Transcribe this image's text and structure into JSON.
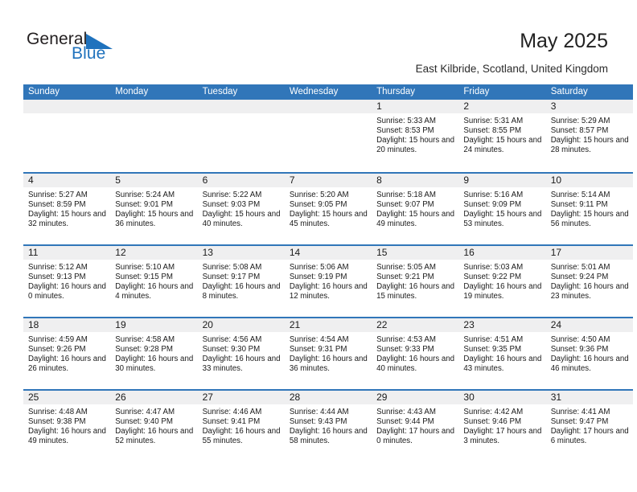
{
  "brand": {
    "name_top": "General",
    "name_bottom": "Blue",
    "color_top": "#231f20",
    "color_bottom": "#1f72bd",
    "triangle_color": "#1f72bd",
    "logo_icon": "triangle-flag-icon"
  },
  "header": {
    "title": "May 2025",
    "subtitle": "East Kilbride, Scotland, United Kingdom"
  },
  "theme": {
    "header_blue": "#3176b9",
    "day_band_gray": "#efeff0",
    "text": "#1a1a1a"
  },
  "weekdays": [
    "Sunday",
    "Monday",
    "Tuesday",
    "Wednesday",
    "Thursday",
    "Friday",
    "Saturday"
  ],
  "weeks": [
    [
      {
        "day": "",
        "empty": true
      },
      {
        "day": "",
        "empty": true
      },
      {
        "day": "",
        "empty": true
      },
      {
        "day": "",
        "empty": true
      },
      {
        "day": "1",
        "sunrise": "Sunrise: 5:33 AM",
        "sunset": "Sunset: 8:53 PM",
        "daylight": "Daylight: 15 hours and 20 minutes."
      },
      {
        "day": "2",
        "sunrise": "Sunrise: 5:31 AM",
        "sunset": "Sunset: 8:55 PM",
        "daylight": "Daylight: 15 hours and 24 minutes."
      },
      {
        "day": "3",
        "sunrise": "Sunrise: 5:29 AM",
        "sunset": "Sunset: 8:57 PM",
        "daylight": "Daylight: 15 hours and 28 minutes."
      }
    ],
    [
      {
        "day": "4",
        "sunrise": "Sunrise: 5:27 AM",
        "sunset": "Sunset: 8:59 PM",
        "daylight": "Daylight: 15 hours and 32 minutes."
      },
      {
        "day": "5",
        "sunrise": "Sunrise: 5:24 AM",
        "sunset": "Sunset: 9:01 PM",
        "daylight": "Daylight: 15 hours and 36 minutes."
      },
      {
        "day": "6",
        "sunrise": "Sunrise: 5:22 AM",
        "sunset": "Sunset: 9:03 PM",
        "daylight": "Daylight: 15 hours and 40 minutes."
      },
      {
        "day": "7",
        "sunrise": "Sunrise: 5:20 AM",
        "sunset": "Sunset: 9:05 PM",
        "daylight": "Daylight: 15 hours and 45 minutes."
      },
      {
        "day": "8",
        "sunrise": "Sunrise: 5:18 AM",
        "sunset": "Sunset: 9:07 PM",
        "daylight": "Daylight: 15 hours and 49 minutes."
      },
      {
        "day": "9",
        "sunrise": "Sunrise: 5:16 AM",
        "sunset": "Sunset: 9:09 PM",
        "daylight": "Daylight: 15 hours and 53 minutes."
      },
      {
        "day": "10",
        "sunrise": "Sunrise: 5:14 AM",
        "sunset": "Sunset: 9:11 PM",
        "daylight": "Daylight: 15 hours and 56 minutes."
      }
    ],
    [
      {
        "day": "11",
        "sunrise": "Sunrise: 5:12 AM",
        "sunset": "Sunset: 9:13 PM",
        "daylight": "Daylight: 16 hours and 0 minutes."
      },
      {
        "day": "12",
        "sunrise": "Sunrise: 5:10 AM",
        "sunset": "Sunset: 9:15 PM",
        "daylight": "Daylight: 16 hours and 4 minutes."
      },
      {
        "day": "13",
        "sunrise": "Sunrise: 5:08 AM",
        "sunset": "Sunset: 9:17 PM",
        "daylight": "Daylight: 16 hours and 8 minutes."
      },
      {
        "day": "14",
        "sunrise": "Sunrise: 5:06 AM",
        "sunset": "Sunset: 9:19 PM",
        "daylight": "Daylight: 16 hours and 12 minutes."
      },
      {
        "day": "15",
        "sunrise": "Sunrise: 5:05 AM",
        "sunset": "Sunset: 9:21 PM",
        "daylight": "Daylight: 16 hours and 15 minutes."
      },
      {
        "day": "16",
        "sunrise": "Sunrise: 5:03 AM",
        "sunset": "Sunset: 9:22 PM",
        "daylight": "Daylight: 16 hours and 19 minutes."
      },
      {
        "day": "17",
        "sunrise": "Sunrise: 5:01 AM",
        "sunset": "Sunset: 9:24 PM",
        "daylight": "Daylight: 16 hours and 23 minutes."
      }
    ],
    [
      {
        "day": "18",
        "sunrise": "Sunrise: 4:59 AM",
        "sunset": "Sunset: 9:26 PM",
        "daylight": "Daylight: 16 hours and 26 minutes."
      },
      {
        "day": "19",
        "sunrise": "Sunrise: 4:58 AM",
        "sunset": "Sunset: 9:28 PM",
        "daylight": "Daylight: 16 hours and 30 minutes."
      },
      {
        "day": "20",
        "sunrise": "Sunrise: 4:56 AM",
        "sunset": "Sunset: 9:30 PM",
        "daylight": "Daylight: 16 hours and 33 minutes."
      },
      {
        "day": "21",
        "sunrise": "Sunrise: 4:54 AM",
        "sunset": "Sunset: 9:31 PM",
        "daylight": "Daylight: 16 hours and 36 minutes."
      },
      {
        "day": "22",
        "sunrise": "Sunrise: 4:53 AM",
        "sunset": "Sunset: 9:33 PM",
        "daylight": "Daylight: 16 hours and 40 minutes."
      },
      {
        "day": "23",
        "sunrise": "Sunrise: 4:51 AM",
        "sunset": "Sunset: 9:35 PM",
        "daylight": "Daylight: 16 hours and 43 minutes."
      },
      {
        "day": "24",
        "sunrise": "Sunrise: 4:50 AM",
        "sunset": "Sunset: 9:36 PM",
        "daylight": "Daylight: 16 hours and 46 minutes."
      }
    ],
    [
      {
        "day": "25",
        "sunrise": "Sunrise: 4:48 AM",
        "sunset": "Sunset: 9:38 PM",
        "daylight": "Daylight: 16 hours and 49 minutes."
      },
      {
        "day": "26",
        "sunrise": "Sunrise: 4:47 AM",
        "sunset": "Sunset: 9:40 PM",
        "daylight": "Daylight: 16 hours and 52 minutes."
      },
      {
        "day": "27",
        "sunrise": "Sunrise: 4:46 AM",
        "sunset": "Sunset: 9:41 PM",
        "daylight": "Daylight: 16 hours and 55 minutes."
      },
      {
        "day": "28",
        "sunrise": "Sunrise: 4:44 AM",
        "sunset": "Sunset: 9:43 PM",
        "daylight": "Daylight: 16 hours and 58 minutes."
      },
      {
        "day": "29",
        "sunrise": "Sunrise: 4:43 AM",
        "sunset": "Sunset: 9:44 PM",
        "daylight": "Daylight: 17 hours and 0 minutes."
      },
      {
        "day": "30",
        "sunrise": "Sunrise: 4:42 AM",
        "sunset": "Sunset: 9:46 PM",
        "daylight": "Daylight: 17 hours and 3 minutes."
      },
      {
        "day": "31",
        "sunrise": "Sunrise: 4:41 AM",
        "sunset": "Sunset: 9:47 PM",
        "daylight": "Daylight: 17 hours and 6 minutes."
      }
    ]
  ]
}
